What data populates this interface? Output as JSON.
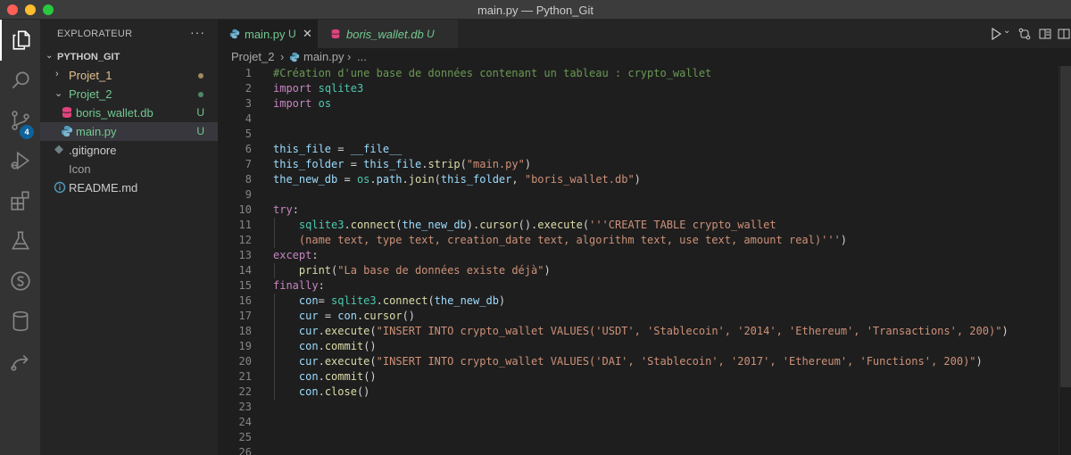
{
  "window": {
    "title": "main.py — Python_Git"
  },
  "sidebar": {
    "title": "EXPLORATEUR",
    "more": "···",
    "workspace": "PYTHON_GIT",
    "items": [
      {
        "label": "Projet_1",
        "status": "",
        "color": "#e2c08d"
      },
      {
        "label": "Projet_2",
        "status": "",
        "color": "#73c991"
      },
      {
        "label": "boris_wallet.db",
        "status": "U",
        "color": "#73c991"
      },
      {
        "label": "main.py",
        "status": "U",
        "color": "#73c991"
      },
      {
        "label": ".gitignore",
        "status": "",
        "color": "#cccccc"
      },
      {
        "label": "Icon",
        "status": "",
        "color": "#cccccc"
      },
      {
        "label": "README.md",
        "status": "",
        "color": "#cccccc"
      }
    ]
  },
  "activity": {
    "scm_badge": "4"
  },
  "tabs": [
    {
      "label": "main.py",
      "status": "U"
    },
    {
      "label": "boris_wallet.db",
      "status": "U"
    }
  ],
  "breadcrumb": {
    "folder": "Projet_2",
    "sep": "›",
    "file": "main.py",
    "more": "..."
  },
  "colors": {
    "accent": "#0e639c",
    "modified": "#e2c08d",
    "untracked": "#73c991"
  },
  "editor": {
    "line_numbers": [
      "1",
      "2",
      "3",
      "4",
      "5",
      "6",
      "7",
      "8",
      "9",
      "10",
      "11",
      "12",
      "13",
      "14",
      "15",
      "16",
      "17",
      "18",
      "19",
      "20",
      "21",
      "22",
      "23",
      "24",
      "25",
      "26"
    ],
    "lines": [
      [
        [
          "c",
          "#Création d'une base de données contenant un tableau : crypto_wallet"
        ]
      ],
      [
        [
          "k",
          "import"
        ],
        [
          "p",
          " "
        ],
        [
          "t",
          "sqlite3"
        ]
      ],
      [
        [
          "k",
          "import"
        ],
        [
          "p",
          " "
        ],
        [
          "t",
          "os"
        ]
      ],
      [],
      [],
      [
        [
          "v",
          "this_file"
        ],
        [
          "p",
          " = "
        ],
        [
          "v",
          "__file__"
        ]
      ],
      [
        [
          "v",
          "this_folder"
        ],
        [
          "p",
          " = "
        ],
        [
          "v",
          "this_file"
        ],
        [
          "p",
          "."
        ],
        [
          "f",
          "strip"
        ],
        [
          "p",
          "("
        ],
        [
          "s",
          "\"main.py\""
        ],
        [
          "p",
          ")"
        ]
      ],
      [
        [
          "v",
          "the_new_db"
        ],
        [
          "p",
          " = "
        ],
        [
          "t",
          "os"
        ],
        [
          "p",
          "."
        ],
        [
          "v",
          "path"
        ],
        [
          "p",
          "."
        ],
        [
          "f",
          "join"
        ],
        [
          "p",
          "("
        ],
        [
          "v",
          "this_folder"
        ],
        [
          "p",
          ", "
        ],
        [
          "s",
          "\"boris_wallet.db\""
        ],
        [
          "p",
          ")"
        ]
      ],
      [],
      [
        [
          "k",
          "try"
        ],
        [
          "p",
          ":"
        ]
      ],
      [
        [
          "p",
          "    "
        ],
        [
          "t",
          "sqlite3"
        ],
        [
          "p",
          "."
        ],
        [
          "f",
          "connect"
        ],
        [
          "p",
          "("
        ],
        [
          "v",
          "the_new_db"
        ],
        [
          "p",
          ")."
        ],
        [
          "f",
          "cursor"
        ],
        [
          "p",
          "()."
        ],
        [
          "f",
          "execute"
        ],
        [
          "p",
          "("
        ],
        [
          "s",
          "'''CREATE TABLE crypto_wallet"
        ]
      ],
      [
        [
          "s",
          "    (name text, type text, creation_date text, algorithm text, use text, amount real)'''"
        ],
        [
          "p",
          ")"
        ]
      ],
      [
        [
          "k",
          "except"
        ],
        [
          "p",
          ":"
        ]
      ],
      [
        [
          "p",
          "    "
        ],
        [
          "f",
          "print"
        ],
        [
          "p",
          "("
        ],
        [
          "s",
          "\"La base de données existe déjà\""
        ],
        [
          "p",
          ")"
        ]
      ],
      [
        [
          "k",
          "finally"
        ],
        [
          "p",
          ":"
        ]
      ],
      [
        [
          "p",
          "    "
        ],
        [
          "v",
          "con"
        ],
        [
          "p",
          "= "
        ],
        [
          "t",
          "sqlite3"
        ],
        [
          "p",
          "."
        ],
        [
          "f",
          "connect"
        ],
        [
          "p",
          "("
        ],
        [
          "v",
          "the_new_db"
        ],
        [
          "p",
          ")"
        ]
      ],
      [
        [
          "p",
          "    "
        ],
        [
          "v",
          "cur"
        ],
        [
          "p",
          " = "
        ],
        [
          "v",
          "con"
        ],
        [
          "p",
          "."
        ],
        [
          "f",
          "cursor"
        ],
        [
          "p",
          "()"
        ]
      ],
      [
        [
          "p",
          "    "
        ],
        [
          "v",
          "cur"
        ],
        [
          "p",
          "."
        ],
        [
          "f",
          "execute"
        ],
        [
          "p",
          "("
        ],
        [
          "s",
          "\"INSERT INTO crypto_wallet VALUES('USDT', 'Stablecoin', '2014', 'Ethereum', 'Transactions', 200)\""
        ],
        [
          "p",
          ")"
        ]
      ],
      [
        [
          "p",
          "    "
        ],
        [
          "v",
          "con"
        ],
        [
          "p",
          "."
        ],
        [
          "f",
          "commit"
        ],
        [
          "p",
          "()"
        ]
      ],
      [
        [
          "p",
          "    "
        ],
        [
          "v",
          "cur"
        ],
        [
          "p",
          "."
        ],
        [
          "f",
          "execute"
        ],
        [
          "p",
          "("
        ],
        [
          "s",
          "\"INSERT INTO crypto_wallet VALUES('DAI', 'Stablecoin', '2017', 'Ethereum', 'Functions', 200)\""
        ],
        [
          "p",
          ")"
        ]
      ],
      [
        [
          "p",
          "    "
        ],
        [
          "v",
          "con"
        ],
        [
          "p",
          "."
        ],
        [
          "f",
          "commit"
        ],
        [
          "p",
          "()"
        ]
      ],
      [
        [
          "p",
          "    "
        ],
        [
          "v",
          "con"
        ],
        [
          "p",
          "."
        ],
        [
          "f",
          "close"
        ],
        [
          "p",
          "()"
        ]
      ],
      [],
      [],
      [],
      []
    ]
  }
}
